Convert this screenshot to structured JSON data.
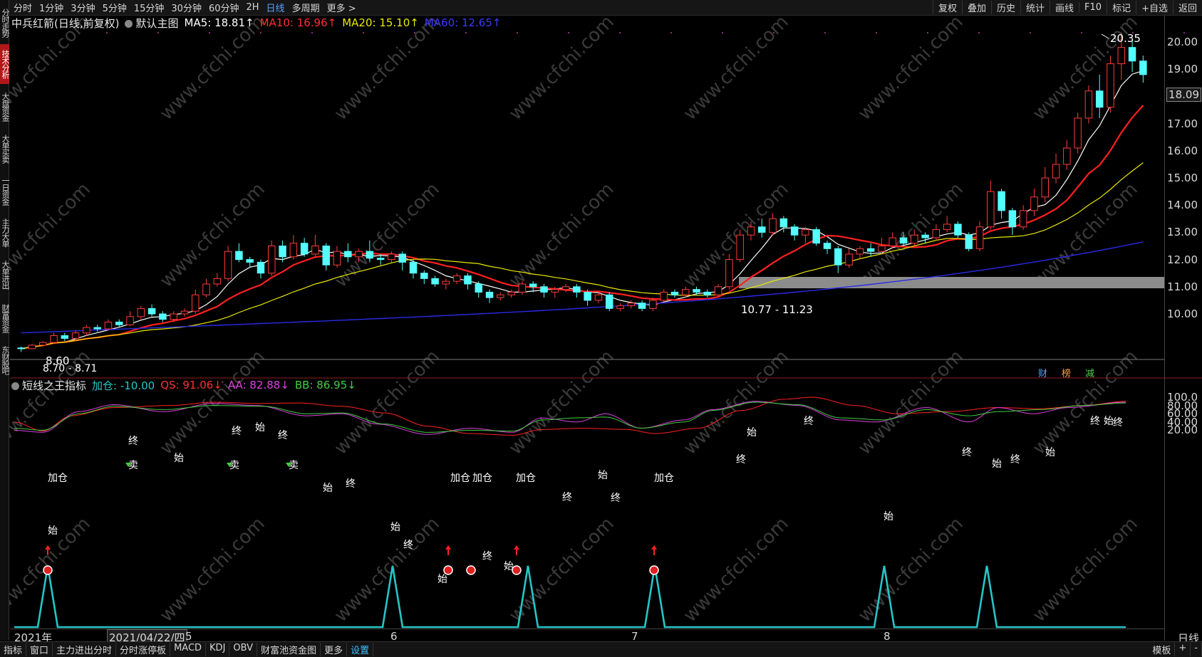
{
  "toolbar": {
    "left": [
      "分时",
      "1分钟",
      "3分钟",
      "5分钟",
      "15分钟",
      "30分钟",
      "60分钟",
      "2H",
      "日线",
      "多周期",
      "更多 >"
    ],
    "active": "日线",
    "right": [
      "复权",
      "叠加",
      "历史",
      "统计",
      "画线",
      "F10",
      "标记",
      "+自选",
      "返回"
    ]
  },
  "sidebar": [
    {
      "label": "分时走势",
      "active": false
    },
    {
      "label": "技术分析",
      "active": true
    },
    {
      "label": "大盘资金",
      "active": false
    },
    {
      "label": "大单买卖",
      "active": false
    },
    {
      "label": "一日资金",
      "active": false
    },
    {
      "label": "主力大单",
      "active": false
    },
    {
      "label": "大单进出",
      "active": false
    },
    {
      "label": "财富资金",
      "active": false
    },
    {
      "label": "东财股吧",
      "active": false
    }
  ],
  "main_info": {
    "stock": "中兵红箭(日线,前复权)",
    "template": "默认主图",
    "ma5": "MA5: 18.81↑",
    "ma10": "MA10: 16.96↑",
    "ma20": "MA20: 15.10↑",
    "ma60": "MA60: 12.65↑"
  },
  "sub_info": {
    "indicator": "短线之王指标",
    "jiacang": "加仓: -10.00",
    "qs": "QS: 91.06↓",
    "aa": "AA: 82.88↓",
    "bb": "BB: 86.95↓"
  },
  "colors": {
    "up": "#ff3b3b",
    "down": "#54ffff",
    "ma5": "#ffffff",
    "ma10": "#ff2020",
    "ma20": "#e8e800",
    "ma60": "#2020e0",
    "qs": "#ff2020",
    "aa": "#e040e0",
    "bb": "#40d040",
    "spike": "#26c6c6",
    "accent": "#5aa0ff"
  },
  "price_axis": [
    "20.00",
    "19.00",
    "18.00",
    "17.00",
    "16.00",
    "15.00",
    "14.00",
    "13.00",
    "12.00",
    "11.00",
    "10.00"
  ],
  "indicator_axis": [
    "100.0",
    "80.00",
    "60.00",
    "40.00",
    "20.00"
  ],
  "current_price": "18.09",
  "high_label": "20.35",
  "low_label": "8.60",
  "low_range": "8.70 - 8.71",
  "range_label": "10.77 - 11.23",
  "date_axis": [
    "2021年",
    "2021/04/22/四",
    "5",
    "6",
    "7",
    "8"
  ],
  "corner_right": "日线",
  "badges": [
    "财",
    "榜",
    "减"
  ],
  "signals": {
    "jiacang": "加仓",
    "sell": "卖",
    "start": "始",
    "end": "终"
  },
  "bottombar": {
    "tabs": [
      "指标",
      "窗口",
      "主力进出分时",
      "分时涨停板",
      "MACD",
      "KDJ",
      "OBV",
      "财富池资金图",
      "更多",
      "设置"
    ],
    "active": "设置",
    "right": [
      "模板",
      "+",
      "-"
    ]
  },
  "watermark": "www.cfchi.com",
  "chart_data": {
    "type": "candlestick",
    "ylim": [
      9.3,
      20.7
    ],
    "candles": [
      [
        8.75,
        8.72,
        8.8,
        8.6
      ],
      [
        8.72,
        8.85,
        8.9,
        8.7
      ],
      [
        8.85,
        8.95,
        9.0,
        8.8
      ],
      [
        8.95,
        9.2,
        9.3,
        8.9
      ],
      [
        9.2,
        9.1,
        9.3,
        9.0
      ],
      [
        9.1,
        9.3,
        9.4,
        9.0
      ],
      [
        9.3,
        9.5,
        9.6,
        9.2
      ],
      [
        9.5,
        9.45,
        9.6,
        9.35
      ],
      [
        9.45,
        9.7,
        9.8,
        9.4
      ],
      [
        9.7,
        9.6,
        9.8,
        9.5
      ],
      [
        9.6,
        9.9,
        10.1,
        9.55
      ],
      [
        9.9,
        10.2,
        10.3,
        9.8
      ],
      [
        10.2,
        10.0,
        10.35,
        9.9
      ],
      [
        10.0,
        9.8,
        10.1,
        9.7
      ],
      [
        9.8,
        10.0,
        10.1,
        9.7
      ],
      [
        10.0,
        10.1,
        10.2,
        9.9
      ],
      [
        10.1,
        10.7,
        10.9,
        10.0
      ],
      [
        10.7,
        11.1,
        11.3,
        10.6
      ],
      [
        11.1,
        11.3,
        11.5,
        11.0
      ],
      [
        11.3,
        12.3,
        12.5,
        11.2
      ],
      [
        12.3,
        12.0,
        12.6,
        11.9
      ],
      [
        12.0,
        11.9,
        12.1,
        11.7
      ],
      [
        11.9,
        11.5,
        12.0,
        11.3
      ],
      [
        11.5,
        12.5,
        12.7,
        11.4
      ],
      [
        12.5,
        12.1,
        12.7,
        11.9
      ],
      [
        12.1,
        12.6,
        12.9,
        12.0
      ],
      [
        12.6,
        12.2,
        12.8,
        12.1
      ],
      [
        12.2,
        12.5,
        12.9,
        12.1
      ],
      [
        12.5,
        11.8,
        12.6,
        11.6
      ],
      [
        11.8,
        12.3,
        12.5,
        11.7
      ],
      [
        12.3,
        12.1,
        12.6,
        11.9
      ],
      [
        12.1,
        12.3,
        12.4,
        11.9
      ],
      [
        12.3,
        12.05,
        12.7,
        11.9
      ],
      [
        12.05,
        12.0,
        12.2,
        11.8
      ],
      [
        12.0,
        12.2,
        12.3,
        11.9
      ],
      [
        12.2,
        11.9,
        12.3,
        11.6
      ],
      [
        11.9,
        11.5,
        12.0,
        11.3
      ],
      [
        11.5,
        11.3,
        11.6,
        11.1
      ],
      [
        11.3,
        11.1,
        11.4,
        11.0
      ],
      [
        11.1,
        11.2,
        11.3,
        10.9
      ],
      [
        11.2,
        11.4,
        11.5,
        11.1
      ],
      [
        11.4,
        11.1,
        11.5,
        10.9
      ],
      [
        11.1,
        10.8,
        11.2,
        10.6
      ],
      [
        10.8,
        10.6,
        10.9,
        10.4
      ],
      [
        10.6,
        10.7,
        10.8,
        10.5
      ],
      [
        10.7,
        10.8,
        10.9,
        10.6
      ],
      [
        10.8,
        11.1,
        11.2,
        10.7
      ],
      [
        11.1,
        11.0,
        11.2,
        10.8
      ],
      [
        11.0,
        10.8,
        11.1,
        10.6
      ],
      [
        10.8,
        10.9,
        11.0,
        10.6
      ],
      [
        10.9,
        11.0,
        11.1,
        10.8
      ],
      [
        11.0,
        10.8,
        11.1,
        10.6
      ],
      [
        10.8,
        10.5,
        10.9,
        10.3
      ],
      [
        10.5,
        10.7,
        10.8,
        10.4
      ],
      [
        10.7,
        10.2,
        10.8,
        10.1
      ],
      [
        10.2,
        10.3,
        10.4,
        10.1
      ],
      [
        10.3,
        10.4,
        10.5,
        10.2
      ],
      [
        10.4,
        10.2,
        10.5,
        10.1
      ],
      [
        10.2,
        10.5,
        10.6,
        10.1
      ],
      [
        10.5,
        10.8,
        10.9,
        10.4
      ],
      [
        10.8,
        10.7,
        10.9,
        10.6
      ],
      [
        10.7,
        10.9,
        11.0,
        10.6
      ],
      [
        10.9,
        10.8,
        11.0,
        10.7
      ],
      [
        10.8,
        10.7,
        10.9,
        10.6
      ],
      [
        10.7,
        11.0,
        11.1,
        10.6
      ],
      [
        11.0,
        12.0,
        12.2,
        10.9
      ],
      [
        12.0,
        12.9,
        13.1,
        11.9
      ],
      [
        12.9,
        13.2,
        13.4,
        12.7
      ],
      [
        13.2,
        13.0,
        13.5,
        12.8
      ],
      [
        13.0,
        13.5,
        13.7,
        12.9
      ],
      [
        13.5,
        13.2,
        13.6,
        13.0
      ],
      [
        13.2,
        12.9,
        13.3,
        12.7
      ],
      [
        12.9,
        13.1,
        13.2,
        12.6
      ],
      [
        13.1,
        12.6,
        13.2,
        12.5
      ],
      [
        12.6,
        12.4,
        12.7,
        12.2
      ],
      [
        12.4,
        11.8,
        12.5,
        11.5
      ],
      [
        11.8,
        12.2,
        12.4,
        11.7
      ],
      [
        12.2,
        12.4,
        12.5,
        12.0
      ],
      [
        12.4,
        12.3,
        12.6,
        12.1
      ],
      [
        12.3,
        12.5,
        12.8,
        12.2
      ],
      [
        12.5,
        12.8,
        13.0,
        12.4
      ],
      [
        12.8,
        12.6,
        13.0,
        12.5
      ],
      [
        12.6,
        12.9,
        13.1,
        12.5
      ],
      [
        12.9,
        12.8,
        13.0,
        12.6
      ],
      [
        12.8,
        13.1,
        13.3,
        12.7
      ],
      [
        13.1,
        13.3,
        13.6,
        13.0
      ],
      [
        13.3,
        12.9,
        13.4,
        12.8
      ],
      [
        12.9,
        12.4,
        13.0,
        12.3
      ],
      [
        12.4,
        13.2,
        13.4,
        12.3
      ],
      [
        13.2,
        14.5,
        14.9,
        13.1
      ],
      [
        14.5,
        13.8,
        14.6,
        13.5
      ],
      [
        13.8,
        13.2,
        13.9,
        12.9
      ],
      [
        13.2,
        13.8,
        14.0,
        13.1
      ],
      [
        13.8,
        14.3,
        14.6,
        13.6
      ],
      [
        14.3,
        15.0,
        15.4,
        14.1
      ],
      [
        15.0,
        15.5,
        15.9,
        14.8
      ],
      [
        15.5,
        16.1,
        16.4,
        15.3
      ],
      [
        16.1,
        17.2,
        17.4,
        15.9
      ],
      [
        17.2,
        18.2,
        18.4,
        17.0
      ],
      [
        18.2,
        17.6,
        18.8,
        17.2
      ],
      [
        17.6,
        19.2,
        19.5,
        17.4
      ],
      [
        19.2,
        19.8,
        20.35,
        18.6
      ],
      [
        19.8,
        19.3,
        20.1,
        18.9
      ],
      [
        19.3,
        18.8,
        19.5,
        18.5
      ]
    ]
  }
}
